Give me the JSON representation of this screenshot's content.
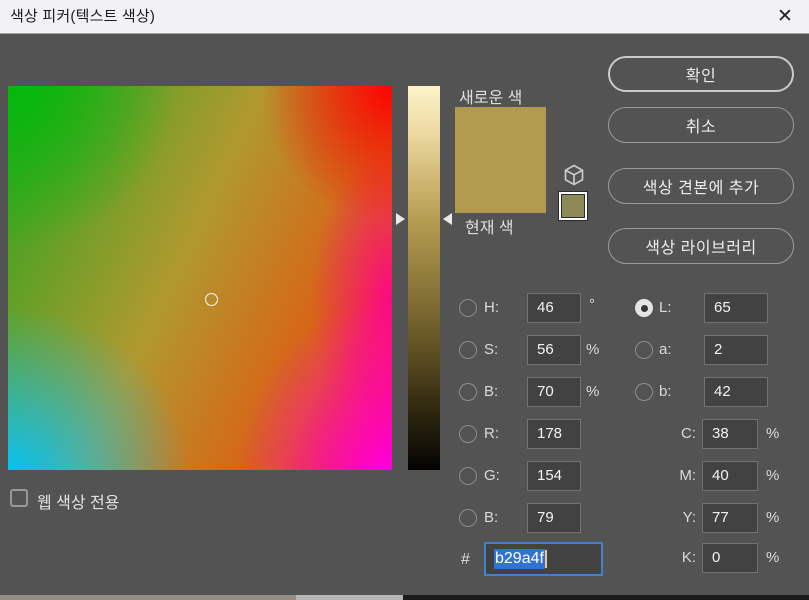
{
  "window": {
    "title": "색상 피커(텍스트 색상)",
    "close_icon": "✕"
  },
  "buttons": {
    "ok": "확인",
    "cancel": "취소",
    "add_swatch": "색상 견본에 추가",
    "libraries": "색상 라이브러리"
  },
  "swatches": {
    "new_label": "새로운 색",
    "current_label": "현재 색",
    "new_color": "#b29a4f",
    "current_color": "#b29a4f",
    "websafe_color": "#8e8a57"
  },
  "checkbox": {
    "label": "웹 색상 전용",
    "checked": false
  },
  "fields": {
    "hsb": [
      {
        "label": "H:",
        "value": "46",
        "unit": "°"
      },
      {
        "label": "S:",
        "value": "56",
        "unit": "%"
      },
      {
        "label": "B:",
        "value": "70",
        "unit": "%"
      }
    ],
    "lab": [
      {
        "label": "L:",
        "value": "65",
        "selected": true
      },
      {
        "label": "a:",
        "value": "2",
        "selected": false
      },
      {
        "label": "b:",
        "value": "42",
        "selected": false
      }
    ],
    "rgb": [
      {
        "label": "R:",
        "value": "178"
      },
      {
        "label": "G:",
        "value": "154"
      },
      {
        "label": "B:",
        "value": "79"
      }
    ],
    "cmyk": [
      {
        "label": "C:",
        "value": "38",
        "unit": "%"
      },
      {
        "label": "M:",
        "value": "40",
        "unit": "%"
      },
      {
        "label": "Y:",
        "value": "77",
        "unit": "%"
      },
      {
        "label": "K:",
        "value": "0",
        "unit": "%"
      }
    ],
    "hex": {
      "prefix": "#",
      "value": "b29a4f"
    }
  },
  "colors": {
    "dialog_bg": "#535353",
    "titlebar_bg": "#f2f2f4",
    "input_bg": "#424242",
    "focus_accent": "#3f82d4",
    "selection": "#3273d2",
    "picked_color": "#b29a4f"
  }
}
